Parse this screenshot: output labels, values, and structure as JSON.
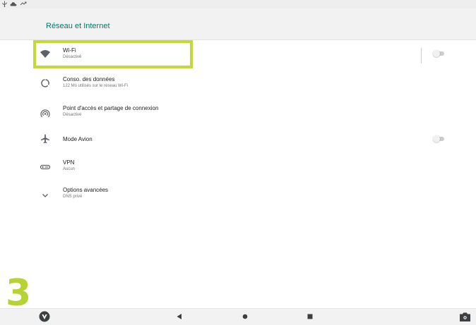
{
  "status_bar": {
    "icons": [
      "usb-icon",
      "cloud-icon",
      "signal-icon"
    ]
  },
  "header": {
    "title": "Réseau et Internet",
    "title_color": "#00796b"
  },
  "settings": {
    "items": [
      {
        "id": "wifi",
        "icon": "wifi-icon",
        "title": "Wi-Fi",
        "subtitle": "Désactivé",
        "toggle": "off"
      },
      {
        "id": "data-usage",
        "icon": "data-usage-icon",
        "title": "Conso. des données",
        "subtitle": "122 Mo utilisés sur le réseau Wi-Fi"
      },
      {
        "id": "hotspot",
        "icon": "hotspot-icon",
        "title": "Point d'accès et partage de connexion",
        "subtitle": "Désactivé"
      },
      {
        "id": "airplane",
        "icon": "airplane-icon",
        "title": "Mode Avion",
        "subtitle": "",
        "toggle": "off"
      },
      {
        "id": "vpn",
        "icon": "vpn-key-icon",
        "title": "VPN",
        "subtitle": "Aucun"
      },
      {
        "id": "advanced",
        "icon": "chevron-down-icon",
        "title": "Options avancées",
        "subtitle": "DNS privé"
      }
    ]
  },
  "annotation": {
    "step_number": "3",
    "highlight_color": "#c5d935"
  },
  "nav_bar": {
    "icons": [
      "app-logo-icon",
      "back-icon",
      "home-icon",
      "recents-icon",
      "screenshot-icon"
    ]
  }
}
